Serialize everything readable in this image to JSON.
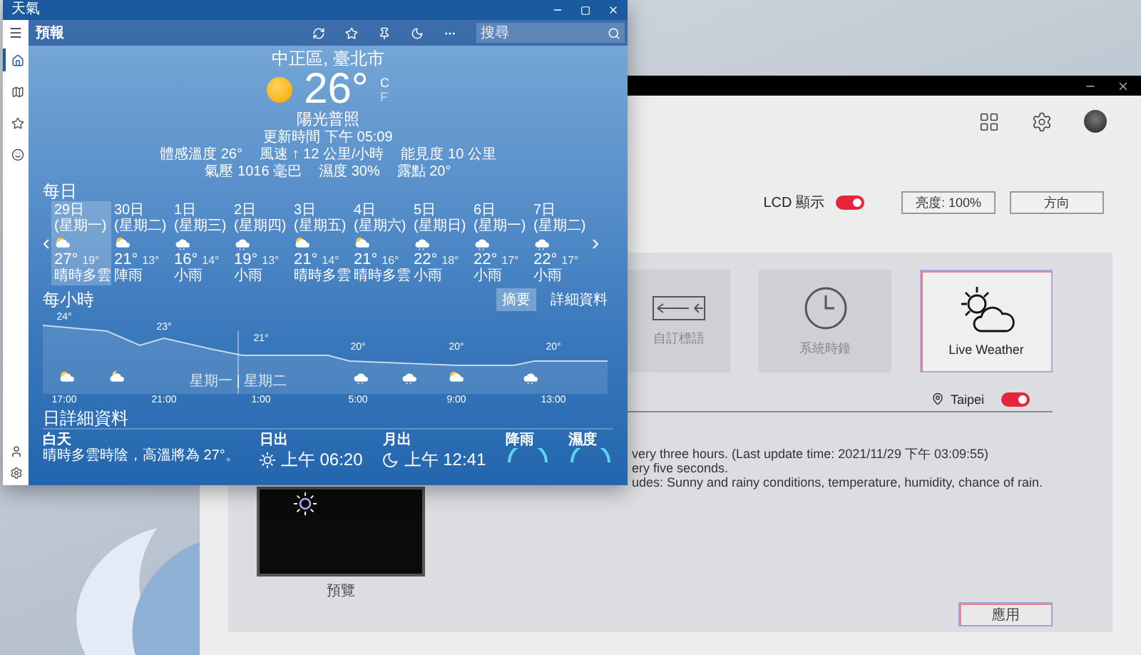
{
  "weather_window": {
    "title": "天氣",
    "header": "預報",
    "search": {
      "placeholder": "搜尋"
    },
    "rail": [
      {
        "kind": "home",
        "selected": true
      },
      {
        "kind": "map",
        "selected": false
      },
      {
        "kind": "star",
        "selected": false
      },
      {
        "kind": "smile",
        "selected": false
      }
    ],
    "location": "中正區, 臺北市",
    "temperature": "26°",
    "units": [
      {
        "label": "C",
        "selected": true
      },
      {
        "label": "F",
        "selected": false
      }
    ],
    "condition": "陽光普照",
    "updated": "更新時間 下午 05:09",
    "details": [
      [
        "體感溫度 26°",
        "風速 ↑ 12 公里/小時",
        "能見度 10 公里"
      ],
      [
        "氣壓 1016 毫巴",
        "濕度 30%",
        "露點 20°"
      ]
    ],
    "daily": {
      "title": "每日",
      "days": [
        {
          "date": "29日 (星期一)",
          "kind": "partly",
          "high": "27°",
          "low": "19°",
          "condition": "晴時多雲",
          "selected": true
        },
        {
          "date": "30日 (星期二)",
          "kind": "partly",
          "high": "21°",
          "low": "13°",
          "condition": "陣雨",
          "selected": false
        },
        {
          "date": "1日 (星期三)",
          "kind": "rain",
          "high": "16°",
          "low": "14°",
          "condition": "小雨",
          "selected": false
        },
        {
          "date": "2日 (星期四)",
          "kind": "rain",
          "high": "19°",
          "low": "13°",
          "condition": "小雨",
          "selected": false
        },
        {
          "date": "3日 (星期五)",
          "kind": "partly",
          "high": "21°",
          "low": "14°",
          "condition": "晴時多雲",
          "selected": false
        },
        {
          "date": "4日 (星期六)",
          "kind": "partly",
          "high": "21°",
          "low": "16°",
          "condition": "晴時多雲",
          "selected": false
        },
        {
          "date": "5日 (星期日)",
          "kind": "rain",
          "high": "22°",
          "low": "18°",
          "condition": "小雨",
          "selected": false
        },
        {
          "date": "6日 (星期一)",
          "kind": "rain",
          "high": "22°",
          "low": "17°",
          "condition": "小雨",
          "selected": false
        },
        {
          "date": "7日 (星期二)",
          "kind": "rain",
          "high": "22°",
          "low": "17°",
          "condition": "小雨",
          "selected": false
        }
      ]
    },
    "hourly": {
      "title": "每小時",
      "buttons": [
        {
          "label": "摘要",
          "selected": true
        },
        {
          "label": "詳細資料",
          "selected": false
        }
      ],
      "temps": [
        "24°",
        "23°",
        "21°",
        "20°",
        "20°",
        "20°"
      ],
      "icons": [
        {
          "kind": "partly"
        },
        {
          "kind": "night"
        },
        {
          "kind": "rain"
        },
        {
          "kind": "rain"
        },
        {
          "kind": "partly"
        },
        {
          "kind": "rain"
        }
      ],
      "day_divider": "星期一 | 星期二",
      "times": [
        "17:00",
        "21:00",
        "1:00",
        "5:00",
        "9:00",
        "13:00"
      ]
    },
    "day_details": {
      "title": "日詳細資料",
      "items": [
        {
          "kind": "text",
          "label": "白天",
          "value": "晴時多雲時陰，高溫將為 27°。"
        },
        {
          "kind": "sunrise",
          "label": "日出",
          "value": "上午 06:20"
        },
        {
          "kind": "moonrise",
          "label": "月出",
          "value": "上午 12:41"
        },
        {
          "kind": "gauge",
          "label": "降雨"
        },
        {
          "kind": "gauge",
          "label": "濕度"
        }
      ]
    }
  },
  "app_window": {
    "lcd": {
      "label": "LCD 顯示",
      "on": true
    },
    "buttons": [
      "亮度: 100%",
      "方向"
    ],
    "modes": [
      {
        "label": "自訂標語",
        "kind": "arrow",
        "selected": false
      },
      {
        "label": "系統時鐘",
        "kind": "clock",
        "selected": false
      },
      {
        "label": "Live Weather",
        "kind": "weather",
        "selected": true
      }
    ],
    "location": {
      "label": "Taipei",
      "on": true
    },
    "notes": [
      "very three hours. (Last update time: 2021/11/29 下午 03:09:55)",
      "ery five seconds.",
      "udes: Sunny and rainy conditions, temperature, humidity, chance of rain."
    ],
    "preview_label": "預覽",
    "apply": "應用"
  }
}
